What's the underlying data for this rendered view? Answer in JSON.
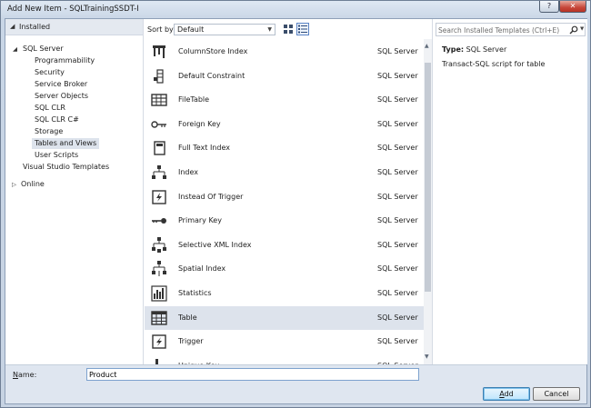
{
  "window": {
    "title": "Add New Item - SQLTrainingSSDT-I",
    "help_label": "?",
    "close_label": "✕"
  },
  "tree": {
    "header": "Installed",
    "nodes": [
      {
        "label": "SQL Server",
        "expander": "◢",
        "level": 0
      },
      {
        "label": "Programmability",
        "level": 1
      },
      {
        "label": "Security",
        "level": 1
      },
      {
        "label": "Service Broker",
        "level": 1
      },
      {
        "label": "Server Objects",
        "level": 1
      },
      {
        "label": "SQL CLR",
        "level": 1
      },
      {
        "label": "SQL CLR C#",
        "level": 1
      },
      {
        "label": "Storage",
        "level": 1
      },
      {
        "label": "Tables and Views",
        "level": 1,
        "selected": true
      },
      {
        "label": "User Scripts",
        "level": 1
      },
      {
        "label": "Visual Studio Templates",
        "level": 0
      },
      {
        "label": "Online",
        "expander": "▷",
        "level": -1
      }
    ]
  },
  "toolbar": {
    "sort_label": "Sort by:",
    "sort_value": "Default",
    "views": [
      "medium-icons-view-icon",
      "list-view-icon"
    ]
  },
  "templates": {
    "items": [
      {
        "name": "ColumnStore Index",
        "type": "SQL Server",
        "icon": "columnstore-index-icon"
      },
      {
        "name": "Default Constraint",
        "type": "SQL Server",
        "icon": "default-constraint-icon"
      },
      {
        "name": "FileTable",
        "type": "SQL Server",
        "icon": "filetable-icon"
      },
      {
        "name": "Foreign Key",
        "type": "SQL Server",
        "icon": "foreign-key-icon"
      },
      {
        "name": "Full Text Index",
        "type": "SQL Server",
        "icon": "full-text-index-icon"
      },
      {
        "name": "Index",
        "type": "SQL Server",
        "icon": "index-icon"
      },
      {
        "name": "Instead Of Trigger",
        "type": "SQL Server",
        "icon": "instead-of-trigger-icon"
      },
      {
        "name": "Primary Key",
        "type": "SQL Server",
        "icon": "primary-key-icon"
      },
      {
        "name": "Selective XML Index",
        "type": "SQL Server",
        "icon": "selective-xml-index-icon"
      },
      {
        "name": "Spatial Index",
        "type": "SQL Server",
        "icon": "spatial-index-icon"
      },
      {
        "name": "Statistics",
        "type": "SQL Server",
        "icon": "statistics-icon"
      },
      {
        "name": "Table",
        "type": "SQL Server",
        "icon": "table-icon",
        "selected": true
      },
      {
        "name": "Trigger",
        "type": "SQL Server",
        "icon": "trigger-icon"
      },
      {
        "name": "Unique Key",
        "type": "SQL Server",
        "icon": "unique-key-icon"
      }
    ]
  },
  "details": {
    "search_placeholder": "Search Installed Templates (Ctrl+E)",
    "type_label": "Type:",
    "type_value": "SQL Server",
    "description": "Transact-SQL script for table"
  },
  "footer": {
    "name_label": "Name:",
    "name_value": "Product",
    "add_label": "Add",
    "cancel_label": "Cancel"
  },
  "colors": {
    "selection": "#dde3ec",
    "title_close": "#c7473a",
    "window_frame": "#c9d6e6"
  }
}
